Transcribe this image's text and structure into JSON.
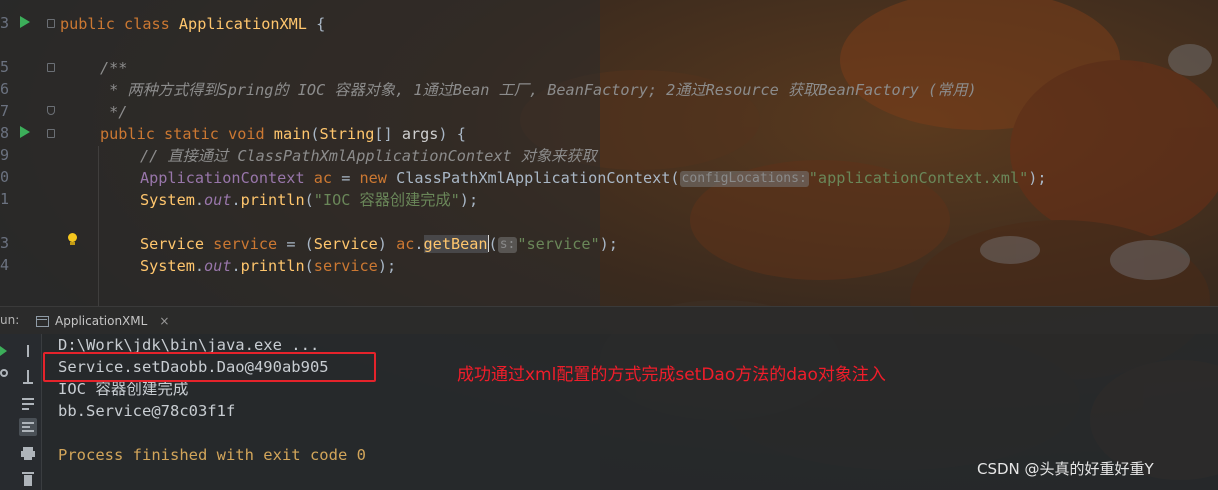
{
  "editor": {
    "line_numbers": [
      "3",
      "5",
      "6",
      "7",
      "8",
      "9",
      "0",
      "1",
      "3",
      "4"
    ],
    "lines": {
      "l3": {
        "kw1": "public",
        "kw2": "class",
        "cls": "ApplicationXML",
        "rest": " {"
      },
      "l5": {
        "cmt": "/**"
      },
      "l6": {
        "cmt": " * 两种方式得到Spring的 IOC 容器对象, 1通过Bean 工厂, BeanFactory; 2通过Resource 获取BeanFactory (常用)"
      },
      "l7": {
        "cmt": " */"
      },
      "l8": {
        "kw1": "public",
        "kw2": "static",
        "kw3": "void",
        "mth": "main",
        "open": "(",
        "type": "String",
        "arr": "[] ",
        "param": "args",
        "close": ") {"
      },
      "l9": {
        "cmt": "// 直接通过 ClassPathXmlApplicationContext 对象来获取"
      },
      "l10": {
        "type": "ApplicationContext",
        "var": "ac",
        "eq": " = ",
        "kw_new": "new",
        "cls2": "ClassPathXmlApplicationContext",
        "open": "(",
        "hint": "configLocations:",
        "str": "\"applicationContext.xml\"",
        "close": ");"
      },
      "l11": {
        "obj": "System",
        "dot1": ".",
        "fld": "out",
        "dot2": ".",
        "mth": "println",
        "open": "(",
        "str": "\"IOC 容器创建完成\"",
        "close": ");"
      },
      "l13": {
        "type": "Service",
        "var": "service",
        "eq": " = (",
        "cast": "Service",
        "mid": ") ",
        "obj": "ac",
        "dot": ".",
        "mth": "getBean",
        "open": "(",
        "hint": "s:",
        "str": "\"service\"",
        "close": ");"
      },
      "l14": {
        "obj": "System",
        "dot1": ".",
        "fld": "out",
        "dot2": ".",
        "mth": "println",
        "open": "(",
        "arg": "service",
        "close": ");"
      }
    }
  },
  "run_panel": {
    "label": "un:",
    "tab_label": "ApplicationXML",
    "tab_close": "×"
  },
  "console": {
    "lines": [
      "D:\\Work\\jdk\\bin\\java.exe ...",
      "Service.setDaobb.Dao@490ab905",
      "IOC 容器创建完成",
      "bb.Service@78c03f1f",
      "",
      "Process finished with exit code 0"
    ]
  },
  "annotation": "成功通过xml配置的方式完成setDao方法的dao对象注入",
  "watermark": "CSDN @头真的好重好重Y",
  "colors": {
    "annotation_red": "#f01d2a",
    "keyword": "#cc7832",
    "string": "#6a8759",
    "method": "#ffc66d",
    "field": "#9876aa",
    "run_green": "#3cae5a"
  }
}
